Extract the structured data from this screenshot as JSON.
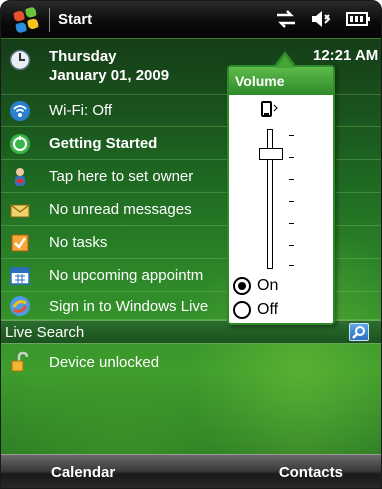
{
  "title_bar": {
    "title": "Start",
    "icons": [
      "windows-flag-icon",
      "connectivity-icon",
      "speaker-muted-icon",
      "battery-icon"
    ]
  },
  "today": {
    "date_line1": "Thursday",
    "date_line2": "January 01, 2009",
    "time": "12:21 AM",
    "items": [
      {
        "label": "Wi-Fi: Off",
        "icon": "wifi-icon",
        "bold": false
      },
      {
        "label": "Getting Started",
        "icon": "getting-started-icon",
        "bold": true
      },
      {
        "label": "Tap here to set owner",
        "icon": "owner-icon",
        "bold": false
      },
      {
        "label": "No unread messages",
        "icon": "envelope-icon",
        "bold": false
      },
      {
        "label": "No tasks",
        "icon": "tasks-icon",
        "bold": false
      },
      {
        "label": "No upcoming appointm",
        "icon": "calendar-icon",
        "bold": false
      },
      {
        "label": "Sign in to Windows Live",
        "icon": "windows-live-icon",
        "bold": false
      }
    ],
    "search_label": "Live Search",
    "device_status": "Device unlocked"
  },
  "volume": {
    "title": "Volume",
    "level": 0.85,
    "options": [
      "On",
      "Off"
    ],
    "selected": "On"
  },
  "softkeys": {
    "left": "Calendar",
    "right": "Contacts"
  },
  "colors": {
    "accent_green": "#2f8a2a",
    "title_bar": "#0a0a0a"
  }
}
